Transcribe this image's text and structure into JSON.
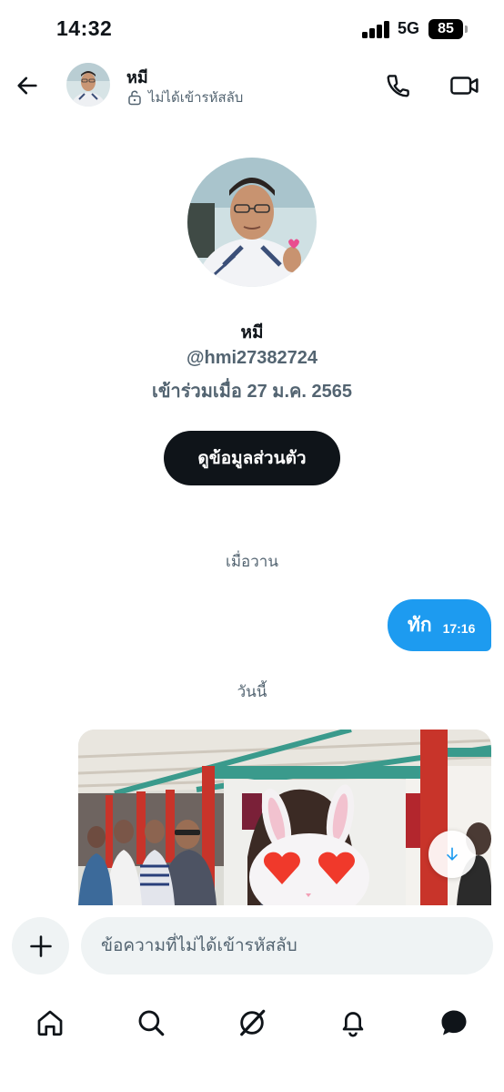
{
  "status_bar": {
    "time": "14:32",
    "network": "5G",
    "battery": "85"
  },
  "header": {
    "name": "หมี",
    "encryption_status": "ไม่ได้เข้ารหัสลับ",
    "icons": {
      "back": "arrow-left-icon",
      "call": "phone-icon",
      "video": "video-camera-icon",
      "lock": "unlock-icon"
    }
  },
  "profile": {
    "name": "หมี",
    "handle": "@hmi27382724",
    "joined": "เข้าร่วมเมื่อ 27 ม.ค. 2565",
    "view_profile_label": "ดูข้อมูลส่วนตัว"
  },
  "conversation": {
    "separators": [
      "เมื่อวาน",
      "วันนี้"
    ],
    "messages": [
      {
        "type": "text",
        "direction": "outgoing",
        "text": "ทัก",
        "time": "17:16"
      },
      {
        "type": "image",
        "direction": "incoming",
        "sticker": "bunny-heart-eyes"
      }
    ],
    "scroll_down_icon": "arrow-down-icon"
  },
  "composer": {
    "placeholder": "ข้อความที่ไม่ได้เข้ารหัสลับ",
    "value": "",
    "add_icon": "plus-icon"
  },
  "tabbar": {
    "items": [
      {
        "name": "home",
        "icon": "home-icon"
      },
      {
        "name": "search",
        "icon": "search-icon"
      },
      {
        "name": "grok",
        "icon": "grok-icon"
      },
      {
        "name": "notifications",
        "icon": "bell-icon"
      },
      {
        "name": "messages",
        "icon": "message-bubble-icon",
        "active": true
      }
    ]
  },
  "colors": {
    "accent": "#1d9bf0",
    "text": "#0f1419",
    "muted": "#536471",
    "input_bg": "#eff3f4"
  }
}
